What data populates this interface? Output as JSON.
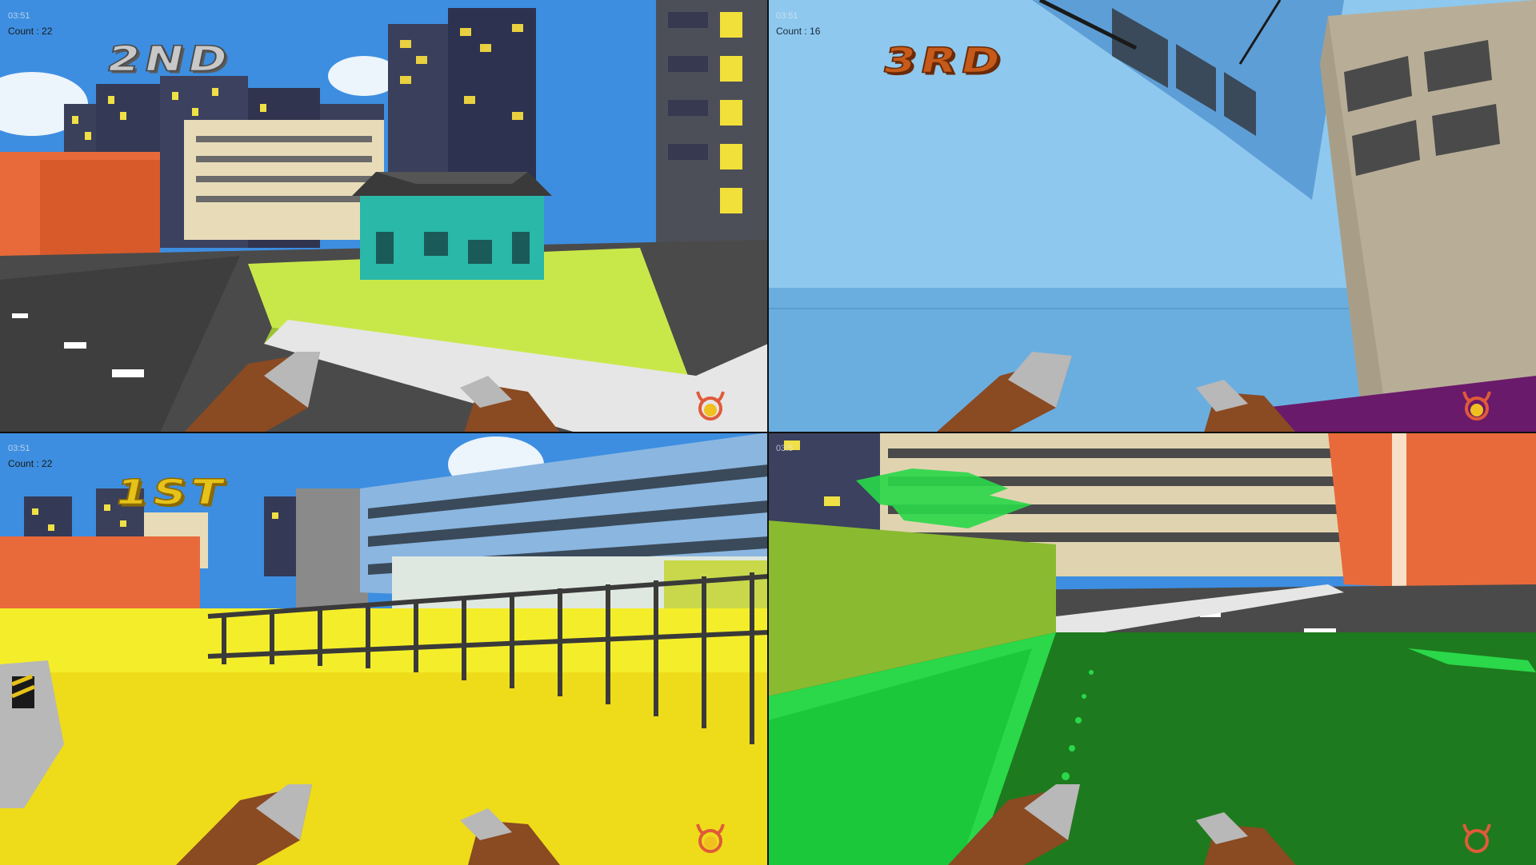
{
  "players": [
    {
      "timer": "03:51",
      "count_label": "Count : 22",
      "rank": "2ND"
    },
    {
      "timer": "03:51",
      "count_label": "Count : 16",
      "rank": "3RD"
    },
    {
      "timer": "03:51",
      "count_label": "Count : 22",
      "rank": "1ST"
    },
    {
      "timer": "03:5",
      "count_label": "",
      "rank": ""
    }
  ],
  "colors": {
    "player1_paint": "#c8e84a",
    "player2_paint": "#6a1a6a",
    "player3_paint": "#f4ee2a",
    "player4_paint": "#1e7a1e",
    "sky": "#3d8ee0",
    "emblem": "#e05a3a"
  },
  "icons": {
    "emblem": "horned-emblem-icon",
    "hands": "blocky-hands-icon"
  }
}
